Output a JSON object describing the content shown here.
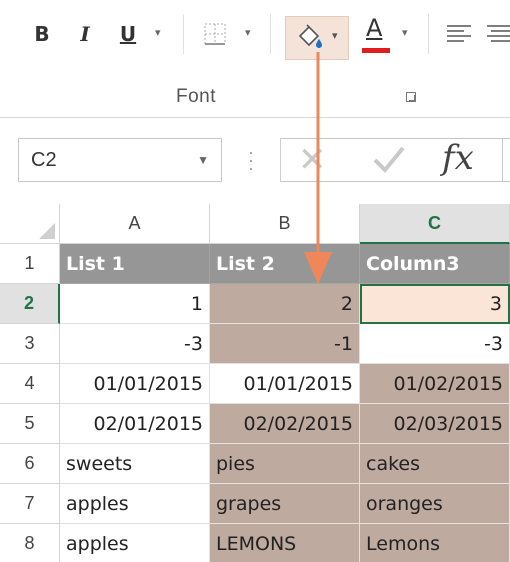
{
  "ribbon": {
    "bold_label": "B",
    "italic_label": "I",
    "underline_label": "U",
    "font_color_label": "A",
    "font_group_label": "Font",
    "fill_color": "#f4e3d8",
    "font_color": "#e01e1e"
  },
  "formula_bar": {
    "name_box": "C2",
    "fx_label": "fx"
  },
  "grid": {
    "columns": [
      "A",
      "B",
      "C"
    ],
    "selected_column": "C",
    "rows": [
      "1",
      "2",
      "3",
      "4",
      "5",
      "6",
      "7",
      "8"
    ],
    "selected_row": "2",
    "cells": [
      [
        "List 1",
        "List 2",
        "Column3"
      ],
      [
        "1",
        "2",
        "3"
      ],
      [
        "-3",
        "-1",
        "-3"
      ],
      [
        "01/01/2015",
        "01/01/2015",
        "01/02/2015"
      ],
      [
        "02/01/2015",
        "02/02/2015",
        "02/03/2015"
      ],
      [
        "sweets",
        "pies",
        "cakes"
      ],
      [
        "apples",
        "grapes",
        "oranges"
      ],
      [
        "apples",
        "LEMONS",
        "Lemons"
      ]
    ],
    "header_color": "#969696",
    "highlight_color": "#bfaaa0",
    "active_cell_color": "#fbe5d6",
    "selection_color": "#217346"
  },
  "annotation": {
    "arrow_color": "#f0875a"
  }
}
